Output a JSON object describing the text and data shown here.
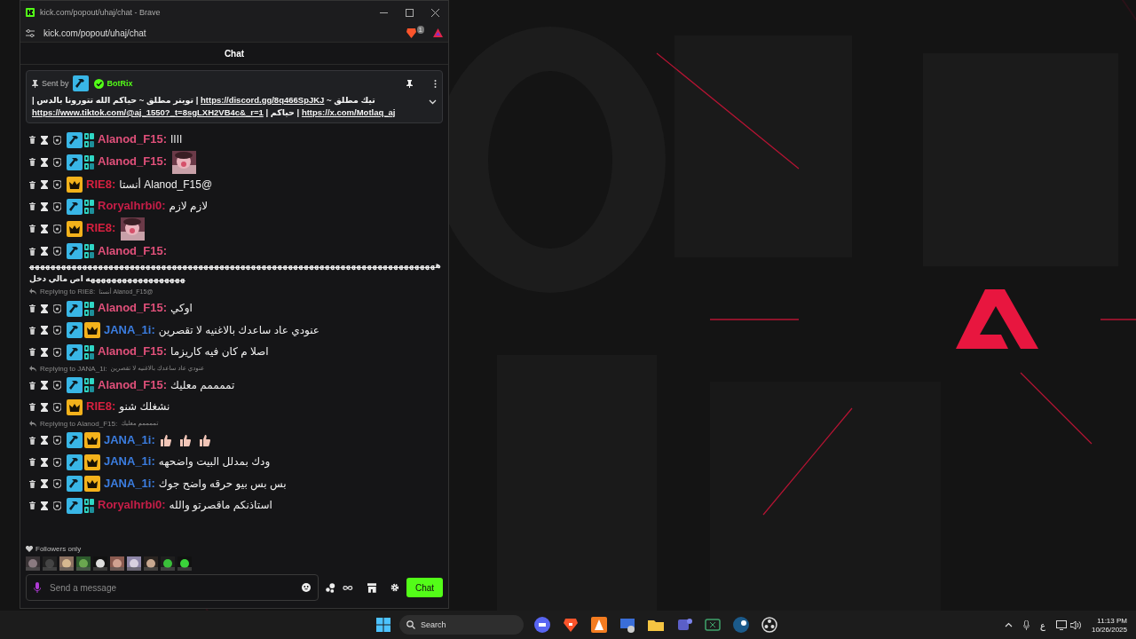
{
  "browser": {
    "title": "kick.com/popout/uhaj/chat - Brave",
    "url": "kick.com/popout/uhaj/chat",
    "shield_count": "1"
  },
  "chat": {
    "title": "Chat",
    "pinned": {
      "sent_by": "Sent by",
      "author": "BotRix",
      "segments": [
        {
          "kind": "text",
          "text": "تيك مطلق ~ "
        },
        {
          "kind": "link",
          "text": "https://discord.gg/8q466SpJKJ"
        },
        {
          "kind": "text",
          "text": " | تويتر مطلق ~ حياكم الله تتورونا بالدس | "
        },
        {
          "kind": "link",
          "text": "https://x.com/Motlaq_aj"
        },
        {
          "kind": "text",
          "text": " | حياكم | "
        },
        {
          "kind": "link",
          "text": "https://www.tiktok.com/@aj_1550?_t=8sgLXH2VB4c&_r=1"
        }
      ]
    },
    "messages": [
      {
        "kind": "message",
        "badges": [
          {
            "kind": "mod"
          },
          {
            "kind": "og"
          }
        ],
        "name": "Alanod_F15:",
        "color": "#e0507a",
        "text": "اااا"
      },
      {
        "kind": "message",
        "badges": [
          {
            "kind": "mod"
          },
          {
            "kind": "og"
          }
        ],
        "name": "Alanod_F15:",
        "color": "#e0507a",
        "emotes": [
          {
            "kind": "picture"
          }
        ]
      },
      {
        "kind": "message",
        "badges": [
          {
            "kind": "crown"
          }
        ],
        "name": "RIE8:",
        "color": "#d8203f",
        "text": "@Alanod_F15 أنستا"
      },
      {
        "kind": "message",
        "badges": [
          {
            "kind": "mod"
          },
          {
            "kind": "og"
          }
        ],
        "name": "Roryalhrbi0:",
        "color": "#c81e48",
        "text": "لازم لازم"
      },
      {
        "kind": "message",
        "badges": [
          {
            "kind": "crown"
          }
        ],
        "name": "RIE8:",
        "color": "#d8203f",
        "emotes": [
          {
            "kind": "picture"
          }
        ]
      },
      {
        "kind": "message",
        "badges": [
          {
            "kind": "mod"
          },
          {
            "kind": "og"
          }
        ],
        "name": "Alanod_F15:",
        "color": "#e0507a",
        "text": "ههههههههههههههههههههههههههههههههههههههههههههههههههههههههههههههههههههههههههههههههههههههههههههههههه اص مالي دخل"
      },
      {
        "kind": "reply",
        "to": "Replying to RIE8:",
        "quote": "@Alanod_F15 أنستا"
      },
      {
        "kind": "message",
        "badges": [
          {
            "kind": "mod"
          },
          {
            "kind": "og"
          }
        ],
        "name": "Alanod_F15:",
        "color": "#e0507a",
        "text": "اوكي"
      },
      {
        "kind": "message",
        "badges": [
          {
            "kind": "mod"
          },
          {
            "kind": "crown"
          }
        ],
        "name": "JANA_1i:",
        "color": "#3b7de0",
        "text": "عنودي عاد ساعدك بالاغنيه لا تقصرين"
      },
      {
        "kind": "message",
        "badges": [
          {
            "kind": "mod"
          },
          {
            "kind": "og"
          }
        ],
        "name": "Alanod_F15:",
        "color": "#e0507a",
        "text": "اصلا م كان فيه كاريزما"
      },
      {
        "kind": "reply",
        "to": "Replying to JANA_1i:",
        "quote": "عنودي عاد ساعدك بالاغنيه لا تقصرين"
      },
      {
        "kind": "message",
        "badges": [
          {
            "kind": "mod"
          },
          {
            "kind": "og"
          }
        ],
        "name": "Alanod_F15:",
        "color": "#e0507a",
        "text": "تممممم معليك"
      },
      {
        "kind": "message",
        "badges": [
          {
            "kind": "crown"
          }
        ],
        "name": "RIE8:",
        "color": "#d8203f",
        "text": "نشغلك شنو"
      },
      {
        "kind": "reply",
        "to": "Replying to Alanod_F15:",
        "quote": "تممممم معليك"
      },
      {
        "kind": "message",
        "badges": [
          {
            "kind": "mod"
          },
          {
            "kind": "crown"
          }
        ],
        "name": "JANA_1i:",
        "color": "#3b7de0",
        "emotes": [
          {
            "kind": "thumb"
          },
          {
            "kind": "thumb"
          },
          {
            "kind": "thumb"
          }
        ]
      },
      {
        "kind": "message",
        "badges": [
          {
            "kind": "mod"
          },
          {
            "kind": "crown"
          }
        ],
        "name": "JANA_1i:",
        "color": "#3b7de0",
        "text": "ودك بمدلل البيت واضحهه"
      },
      {
        "kind": "message",
        "badges": [
          {
            "kind": "mod"
          },
          {
            "kind": "crown"
          }
        ],
        "name": "JANA_1i:",
        "color": "#3b7de0",
        "text": "بس بس بيو حرقه واضح جوك"
      },
      {
        "kind": "message",
        "badges": [
          {
            "kind": "mod"
          },
          {
            "kind": "og"
          }
        ],
        "name": "Roryalhrbi0:",
        "color": "#c81e48",
        "text": "استاذنكم ماقصرتو والله"
      }
    ],
    "mode": "Followers only",
    "recent_emotes": [
      {
        "kind": "picture"
      },
      {
        "kind": "picture"
      },
      {
        "kind": "picture"
      },
      {
        "kind": "picture"
      },
      {
        "kind": "picture"
      },
      {
        "kind": "picture"
      },
      {
        "kind": "picture"
      },
      {
        "kind": "picture"
      },
      {
        "kind": "picture"
      },
      {
        "kind": "picture"
      }
    ],
    "input": {
      "placeholder": "Send a message"
    },
    "send_label": "Chat"
  },
  "taskbar": {
    "search": "Search",
    "keyboard": "ع",
    "time": "11:13 PM",
    "date": "10/26/2025"
  }
}
